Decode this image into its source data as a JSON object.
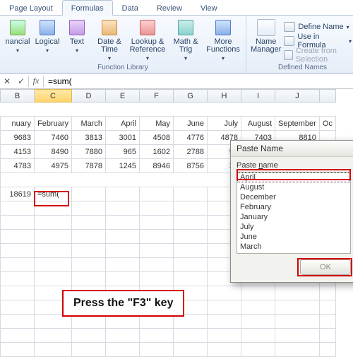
{
  "ribbon": {
    "tabs": [
      "Page Layout",
      "Formulas",
      "Data",
      "Review",
      "View"
    ],
    "active_tab": "Formulas",
    "library_group_label": "Function Library",
    "defined_group_label": "Defined Names",
    "buttons": {
      "financial": "nancial",
      "logical": "Logical",
      "text": "Text",
      "datetime": "Date & Time",
      "lookup": "Lookup & Reference",
      "math": "Math & Trig",
      "more": "More Functions",
      "name_manager": "Name Manager"
    },
    "defined_items": {
      "define_name": "Define Name",
      "use_in_formula": "Use in Formula",
      "create_from_selection": "Create from Selection"
    }
  },
  "formula_bar": {
    "cancel": "✕",
    "enter": "✓",
    "fx": "fx",
    "formula": "=sum("
  },
  "grid": {
    "col_headers": [
      "B",
      "C",
      "D",
      "E",
      "F",
      "G",
      "H",
      "I",
      "J",
      ""
    ],
    "active_col": "C",
    "month_row": [
      "nuary",
      "February",
      "March",
      "April",
      "May",
      "June",
      "July",
      "August",
      "September",
      "Oc"
    ],
    "rows": [
      [
        "9683",
        "7460",
        "3813",
        "3001",
        "4508",
        "4776",
        "4878",
        "7403",
        "8810",
        ""
      ],
      [
        "4153",
        "8490",
        "7880",
        "965",
        "1602",
        "2788",
        "98",
        "",
        "",
        ""
      ],
      [
        "4783",
        "4975",
        "7878",
        "1245",
        "8946",
        "8756",
        "32",
        "",
        "",
        ""
      ]
    ],
    "sum_row_label": "18619",
    "active_cell_value": "=sum("
  },
  "callout_text": "Press the \"F3\" key",
  "dialog": {
    "title": "Paste Name",
    "label_prefix": "Paste ",
    "label_underlined": "n",
    "label_suffix": "ame",
    "options": [
      "April",
      "August",
      "December",
      "February",
      "January",
      "July",
      "June",
      "March"
    ],
    "selected": "April",
    "ok": "OK"
  }
}
